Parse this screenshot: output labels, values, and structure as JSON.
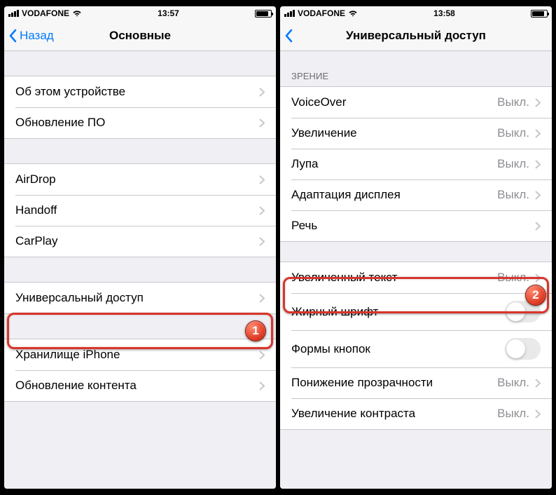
{
  "status": {
    "carrier": "VODAFONE",
    "time": "13:57"
  },
  "status2": {
    "time": "13:58"
  },
  "left": {
    "back": "Назад",
    "title": "Основные",
    "group1": [
      {
        "label": "Об этом устройстве"
      },
      {
        "label": "Обновление ПО"
      }
    ],
    "group2": [
      {
        "label": "AirDrop"
      },
      {
        "label": "Handoff"
      },
      {
        "label": "CarPlay"
      }
    ],
    "group3": [
      {
        "label": "Универсальный доступ"
      }
    ],
    "group4": [
      {
        "label": "Хранилище iPhone"
      },
      {
        "label": "Обновление контента"
      }
    ],
    "marker": "1"
  },
  "right": {
    "title": "Универсальный доступ",
    "section": "ЗРЕНИЕ",
    "items": [
      {
        "label": "VoiceOver",
        "value": "Выкл."
      },
      {
        "label": "Увеличение",
        "value": "Выкл."
      },
      {
        "label": "Лупа",
        "value": "Выкл."
      },
      {
        "label": "Адаптация дисплея",
        "value": "Выкл."
      },
      {
        "label": "Речь"
      },
      {
        "label": "Увеличенный текст",
        "value": "Выкл."
      },
      {
        "label": "Жирный шрифт",
        "switch": true
      },
      {
        "label": "Формы кнопок",
        "switch": true
      },
      {
        "label": "Понижение прозрачности",
        "value": "Выкл."
      },
      {
        "label": "Увеличение контраста",
        "value": "Выкл."
      }
    ],
    "marker": "2"
  }
}
